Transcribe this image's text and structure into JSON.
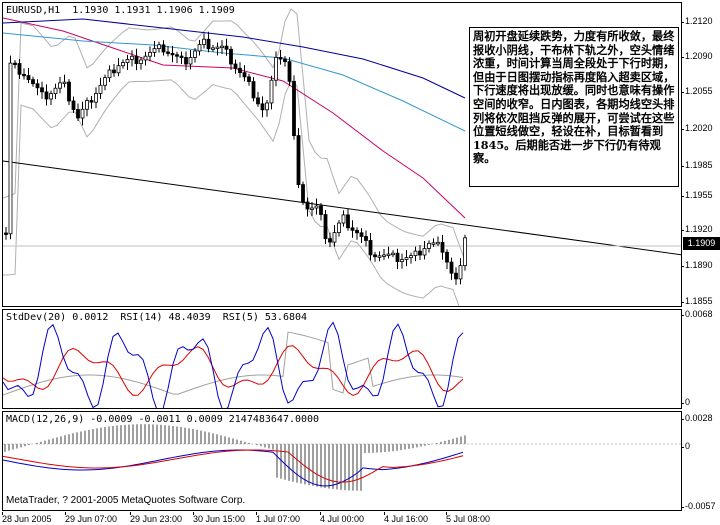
{
  "main": {
    "label": "EURUSD,H1  1.1930 1.1931 1.1906 1.1909",
    "current_price": "1.1909",
    "y_ticks": [
      "1.2120",
      "1.2090",
      "1.2055",
      "1.2020",
      "1.1985",
      "1.1955",
      "1.1920",
      "1.1890",
      "1.1855"
    ],
    "commentary": "周初开盘延续跌势，力度有所收敛，最终报收小阴线，干布林下轨之外，空头情绪浓重，时间计算当周全段处于下行时期，但由于日图摆动指标再度陷入超卖区域，下行速度将出现放缓。同时也意味有操作空间的收窄。日内图表，各期均线空头排列将依次阻挡反弹的展开，可尝试在这些位置短线做空，轻设在补，目标暂看到1845。后期能否进一步下行仍有待观察。",
    "colors": {
      "bull": "#000000",
      "bear": "#000000",
      "ma_fast": "#cc0066",
      "ma_mid": "#3399cc",
      "ma_slow": "#000099",
      "bands": "#b0b0b0",
      "trendline": "#000000"
    }
  },
  "indicator": {
    "label": "StdDev(20) 0.0012  RSI(14) 48.4039  RSI(5) 53.6804",
    "y_ticks": [
      "0.0068",
      "0"
    ],
    "colors": {
      "stddev": "#a0a0a0",
      "rsi14": "#dd0000",
      "rsi5": "#0000cc"
    }
  },
  "macd": {
    "label": "MACD(12,26,9) -0.0009 -0.0011 0.0009 2147483647.0000",
    "y_ticks": [
      "0.0028",
      "0",
      "-0.0057"
    ],
    "colors": {
      "histogram": "#a0a0a0",
      "macd": "#0000cc",
      "signal": "#dd0000"
    }
  },
  "copyright": "MetaTrader, ? 2001-2005 MetaQuotes Software Corp.",
  "x_ticks": [
    "28 Jun 2005",
    "29 Jun 07:00",
    "29 Jun 23:00",
    "30 Jun 15:00",
    "1 Jul 07:00",
    "4 Jul 00:00",
    "4 Jul 16:00",
    "5 Jul 08:00"
  ]
}
